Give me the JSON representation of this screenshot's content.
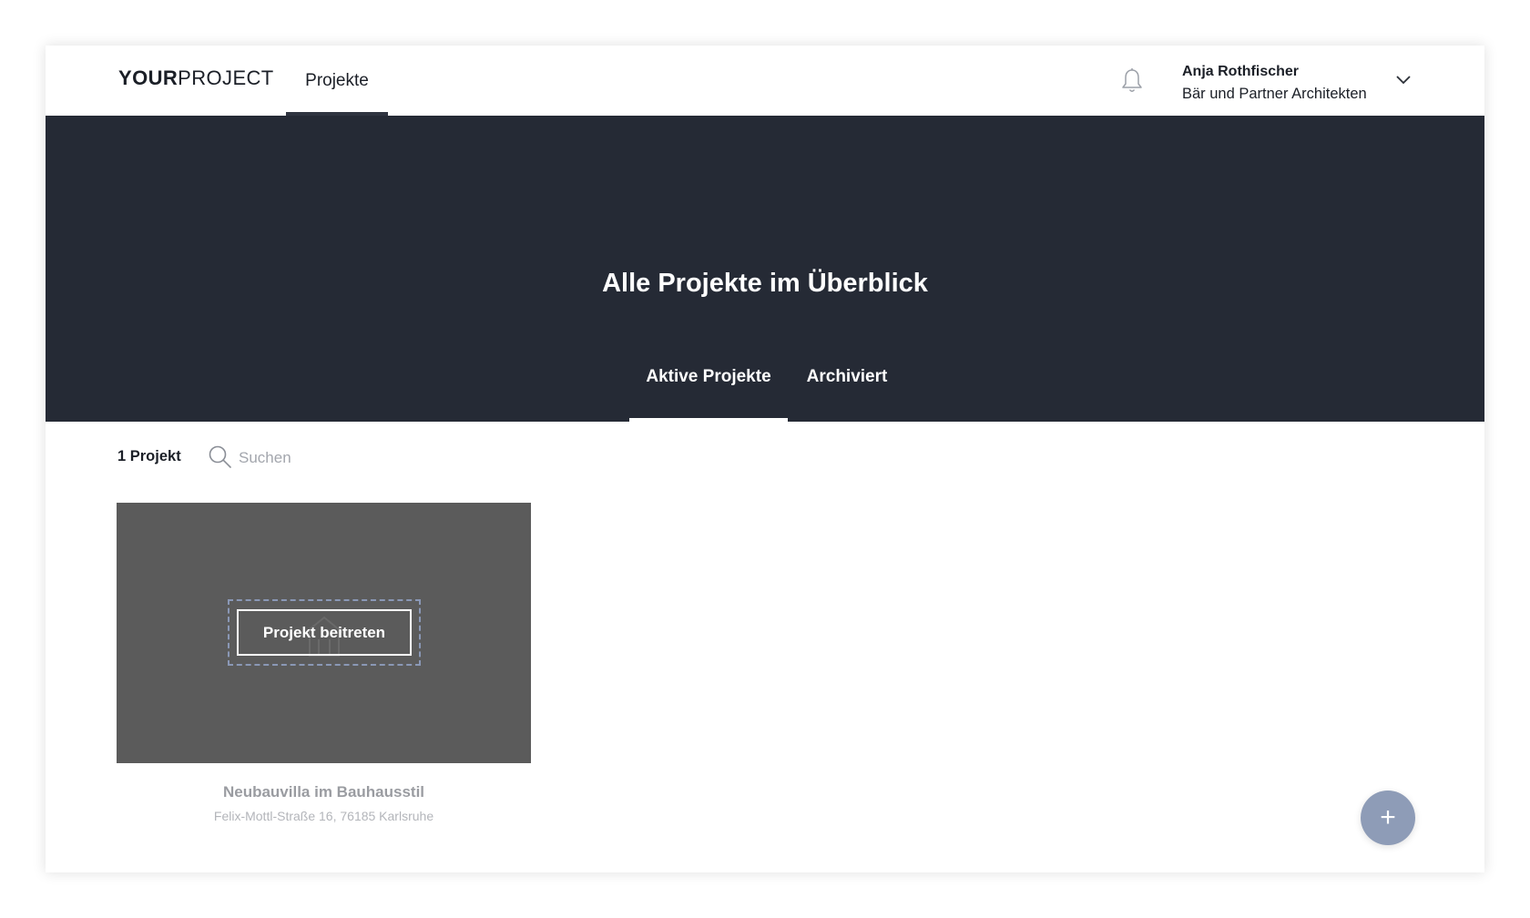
{
  "header": {
    "logo_bold": "YOUR",
    "logo_light": "PROJECT",
    "nav_projects": "Projekte",
    "bell_icon": "bell-icon",
    "user_name": "Anja Rothfischer",
    "user_company": "Bär und Partner Architekten",
    "chevron_icon": "chevron-down-icon"
  },
  "hero": {
    "title": "Alle Projekte im Überblick",
    "tabs": [
      {
        "label": "Aktive Projekte",
        "active": true
      },
      {
        "label": "Archiviert",
        "active": false
      }
    ]
  },
  "toolbar": {
    "count": "1 Projekt",
    "search_icon": "search-icon",
    "search_placeholder": "Suchen",
    "search_value": ""
  },
  "projects": [
    {
      "title": "Neubauvilla im Bauhausstil",
      "address": "Felix-Mottl-Straße 16, 76185 Karlsruhe",
      "join_label": "Projekt beitreten",
      "placeholder_icon": "house-icon"
    }
  ],
  "fab": {
    "label": "+",
    "icon": "plus-icon"
  },
  "colors": {
    "hero_bg": "#252a35",
    "card_bg": "#5b5b5b",
    "accent": "#8e9cb7",
    "text_dark": "#1b1f27"
  }
}
